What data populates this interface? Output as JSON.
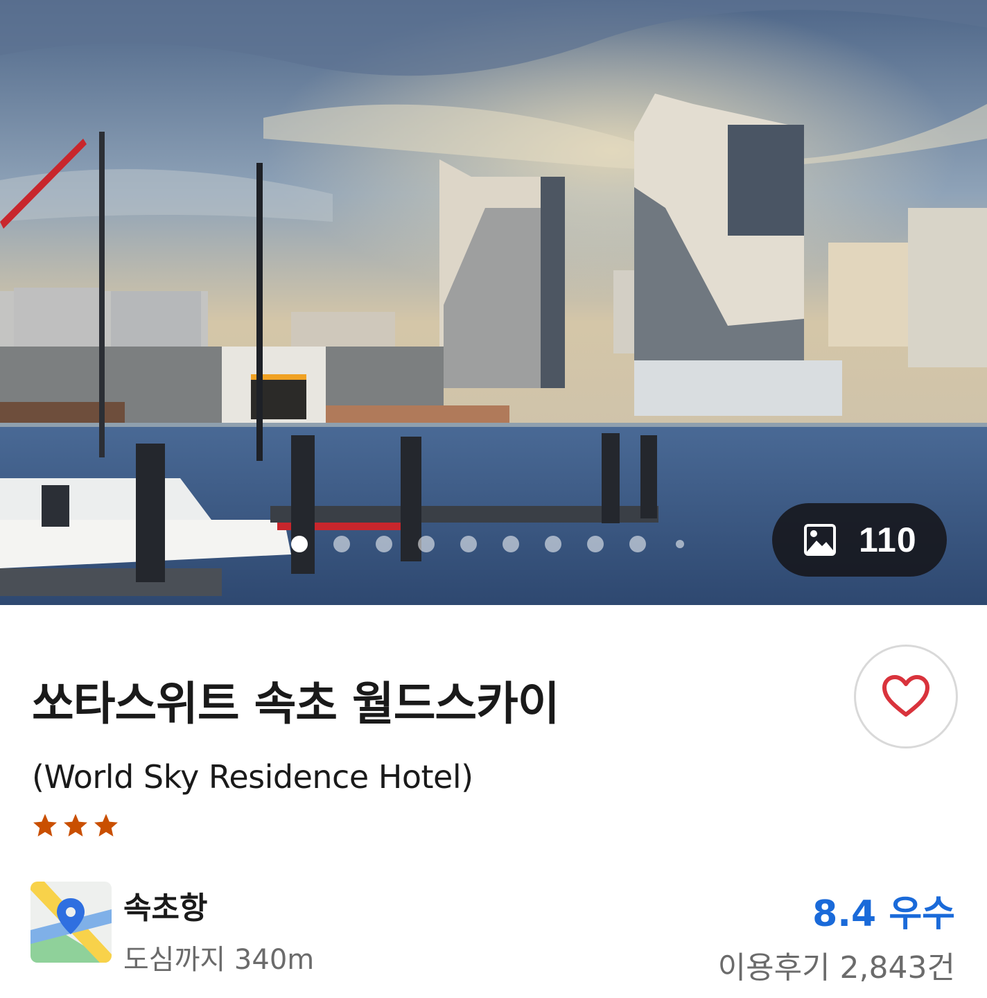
{
  "gallery": {
    "photo_count": "110",
    "dot_count": 10,
    "active_index": 0
  },
  "hotel": {
    "name": "쏘타스위트 속초 월드스카이",
    "english_name": "(World Sky Residence Hotel)",
    "star_rating": 3,
    "star_color": "#c94f00"
  },
  "location": {
    "name": "속초항",
    "distance": "도심까지 340m"
  },
  "rating": {
    "score_text": "8.4 우수",
    "reviews_text": "이용후기 2,843건",
    "accent_color": "#1a6ad9"
  },
  "favorite": {
    "icon": "heart-icon",
    "color": "#d9333c"
  }
}
